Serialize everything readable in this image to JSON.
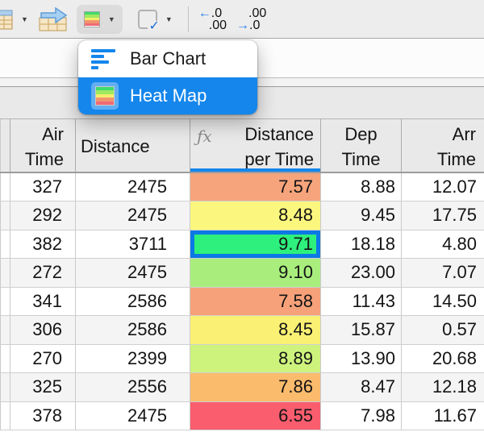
{
  "toolbar": {
    "decimals": {
      "increase": {
        "arrow": "←",
        "top": ".0",
        "bottom": ".00"
      },
      "decrease": {
        "top": ".00",
        "arrow": "→",
        "bottom": ".0"
      }
    },
    "checkbox_glyph": "✓",
    "caret_glyph": "▼"
  },
  "menu": {
    "items": [
      {
        "label": "Bar Chart"
      },
      {
        "label": "Heat Map"
      }
    ],
    "selected_index": 1
  },
  "table": {
    "fx_label": "ƒx",
    "columns": [
      {
        "line1": "",
        "line2": ""
      },
      {
        "line1": "Air",
        "line2": "Time"
      },
      {
        "line1": "Distance",
        "line2": ""
      },
      {
        "line1": "Distance",
        "line2": "per Time"
      },
      {
        "line1": "Dep",
        "line2": "Time"
      },
      {
        "line1": "Arr",
        "line2": "Time"
      }
    ],
    "rows": [
      {
        "air": "327",
        "distance": "2475",
        "dpt": "7.57",
        "color": "#F6A47C",
        "dep": "8.88",
        "arr": "12.07",
        "selected": false
      },
      {
        "air": "292",
        "distance": "2475",
        "dpt": "8.48",
        "color": "#FBF77E",
        "dep": "9.45",
        "arr": "17.75",
        "selected": false
      },
      {
        "air": "382",
        "distance": "3711",
        "dpt": "9.71",
        "color": "#2EF07D",
        "dep": "18.18",
        "arr": "4.80",
        "selected": true
      },
      {
        "air": "272",
        "distance": "2475",
        "dpt": "9.10",
        "color": "#A9EE7D",
        "dep": "23.00",
        "arr": "7.07",
        "selected": false
      },
      {
        "air": "341",
        "distance": "2586",
        "dpt": "7.58",
        "color": "#F6A179",
        "dep": "11.43",
        "arr": "14.50",
        "selected": false
      },
      {
        "air": "306",
        "distance": "2586",
        "dpt": "8.45",
        "color": "#FAF073",
        "dep": "15.87",
        "arr": "0.57",
        "selected": false
      },
      {
        "air": "270",
        "distance": "2399",
        "dpt": "8.89",
        "color": "#CDF37D",
        "dep": "13.90",
        "arr": "20.68",
        "selected": false
      },
      {
        "air": "325",
        "distance": "2556",
        "dpt": "7.86",
        "color": "#FABB6D",
        "dep": "8.47",
        "arr": "12.18",
        "selected": false
      },
      {
        "air": "378",
        "distance": "2475",
        "dpt": "6.55",
        "color": "#F95D6E",
        "dep": "7.98",
        "arr": "11.67",
        "selected": false
      }
    ]
  },
  "colors": {
    "accent_blue": "#1486EC",
    "selection_border": "#0C79E4",
    "heatmap_stripes": [
      "#3FDB6C",
      "#9FE95F",
      "#F2EF6B",
      "#F2946E",
      "#EF6A74"
    ]
  }
}
